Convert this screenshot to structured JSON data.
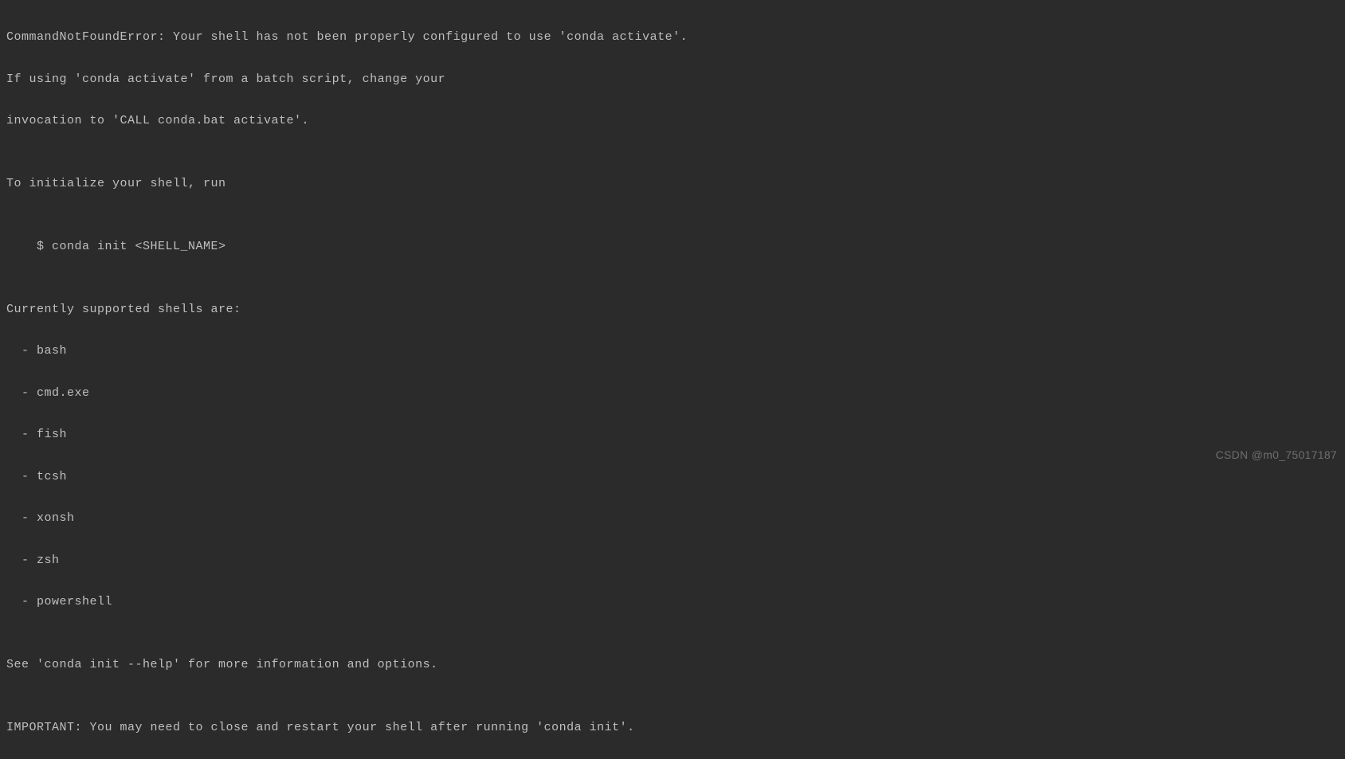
{
  "terminal": {
    "line1": "CommandNotFoundError: Your shell has not been properly configured to use 'conda activate'.",
    "line2": "If using 'conda activate' from a batch script, change your",
    "line3": "invocation to 'CALL conda.bat activate'.",
    "line4": "",
    "line5": "To initialize your shell, run",
    "line6": "",
    "line7": "    $ conda init <SHELL_NAME>",
    "line8": "",
    "line9": "Currently supported shells are:",
    "line10": "  - bash",
    "line11": "  - cmd.exe",
    "line12": "  - fish",
    "line13": "  - tcsh",
    "line14": "  - xonsh",
    "line15": "  - zsh",
    "line16": "  - powershell",
    "line17": "",
    "line18": "See 'conda init --help' for more information and options.",
    "line19": "",
    "line20": "IMPORTANT: You may need to close and restart your shell after running 'conda init'."
  },
  "watermark": "CSDN @m0_75017187"
}
